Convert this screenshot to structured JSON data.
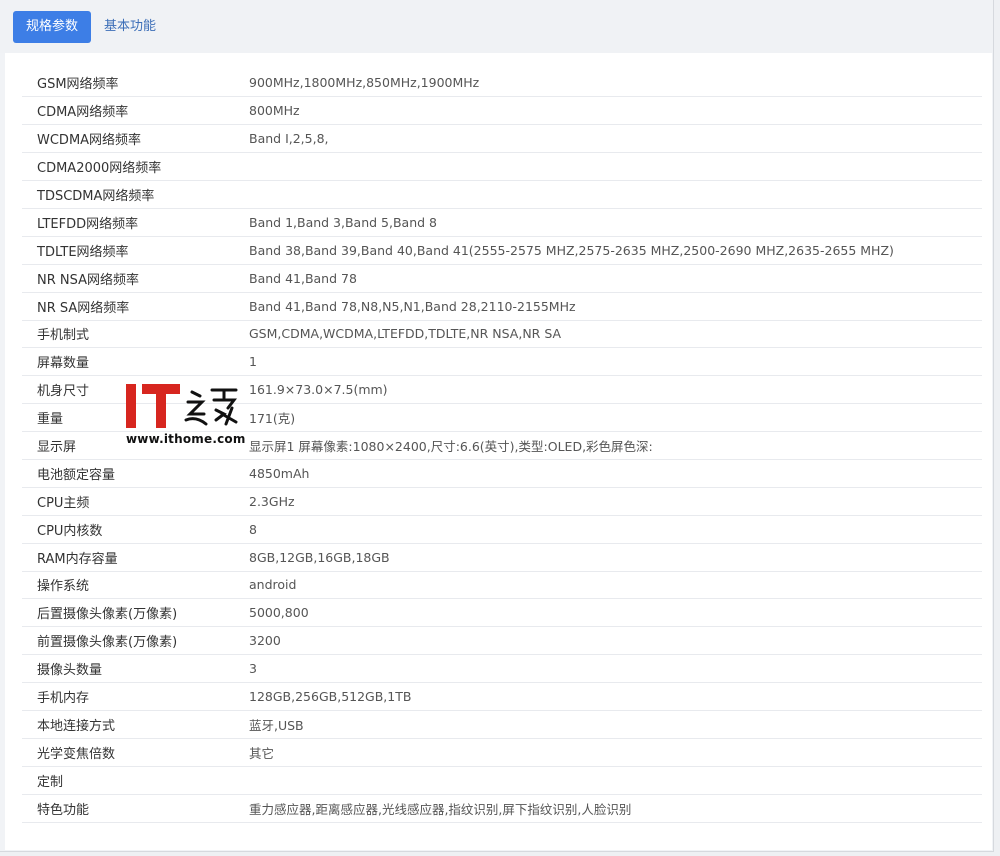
{
  "tabs": [
    {
      "label": "规格参数",
      "active": true
    },
    {
      "label": "基本功能",
      "active": false
    }
  ],
  "specs": [
    {
      "label": "GSM网络频率",
      "value": "900MHz,1800MHz,850MHz,1900MHz"
    },
    {
      "label": "CDMA网络频率",
      "value": "800MHz"
    },
    {
      "label": "WCDMA网络频率",
      "value": "Band Ⅰ,2,5,8,"
    },
    {
      "label": "CDMA2000网络频率",
      "value": ""
    },
    {
      "label": "TDSCDMA网络频率",
      "value": ""
    },
    {
      "label": "LTEFDD网络频率",
      "value": "Band 1,Band 3,Band 5,Band 8"
    },
    {
      "label": "TDLTE网络频率",
      "value": "Band 38,Band 39,Band 40,Band 41(2555-2575 MHZ,2575-2635 MHZ,2500-2690 MHZ,2635-2655 MHZ)"
    },
    {
      "label": "NR NSA网络频率",
      "value": "Band 41,Band 78"
    },
    {
      "label": "NR SA网络频率",
      "value": "Band 41,Band 78,N8,N5,N1,Band 28,2110-2155MHz"
    },
    {
      "label": "手机制式",
      "value": "GSM,CDMA,WCDMA,LTEFDD,TDLTE,NR NSA,NR SA"
    },
    {
      "label": "屏幕数量",
      "value": "1"
    },
    {
      "label": "机身尺寸",
      "value": "161.9×73.0×7.5(mm)"
    },
    {
      "label": "重量",
      "value": "171(克)"
    },
    {
      "label": "显示屏",
      "value": "显示屏1 屏幕像素:1080×2400,尺寸:6.6(英寸),类型:OLED,彩色屏色深:"
    },
    {
      "label": "电池额定容量",
      "value": "4850mAh"
    },
    {
      "label": "CPU主频",
      "value": "2.3GHz"
    },
    {
      "label": "CPU内核数",
      "value": "8"
    },
    {
      "label": "RAM内存容量",
      "value": "8GB,12GB,16GB,18GB"
    },
    {
      "label": "操作系统",
      "value": "android"
    },
    {
      "label": "后置摄像头像素(万像素)",
      "value": "5000,800"
    },
    {
      "label": "前置摄像头像素(万像素)",
      "value": "3200"
    },
    {
      "label": "摄像头数量",
      "value": "3"
    },
    {
      "label": "手机内存",
      "value": "128GB,256GB,512GB,1TB"
    },
    {
      "label": "本地连接方式",
      "value": "蓝牙,USB"
    },
    {
      "label": "光学变焦倍数",
      "value": "其它"
    },
    {
      "label": "定制",
      "value": ""
    },
    {
      "label": "特色功能",
      "value": "重力感应器,距离感应器,光线感应器,指纹识别,屏下指纹识别,人脸识别"
    }
  ],
  "watermark": {
    "url": "www.ithome.com",
    "logo_letters": "IT",
    "logo_chars": "之家",
    "brand_color": "#d7261f"
  }
}
